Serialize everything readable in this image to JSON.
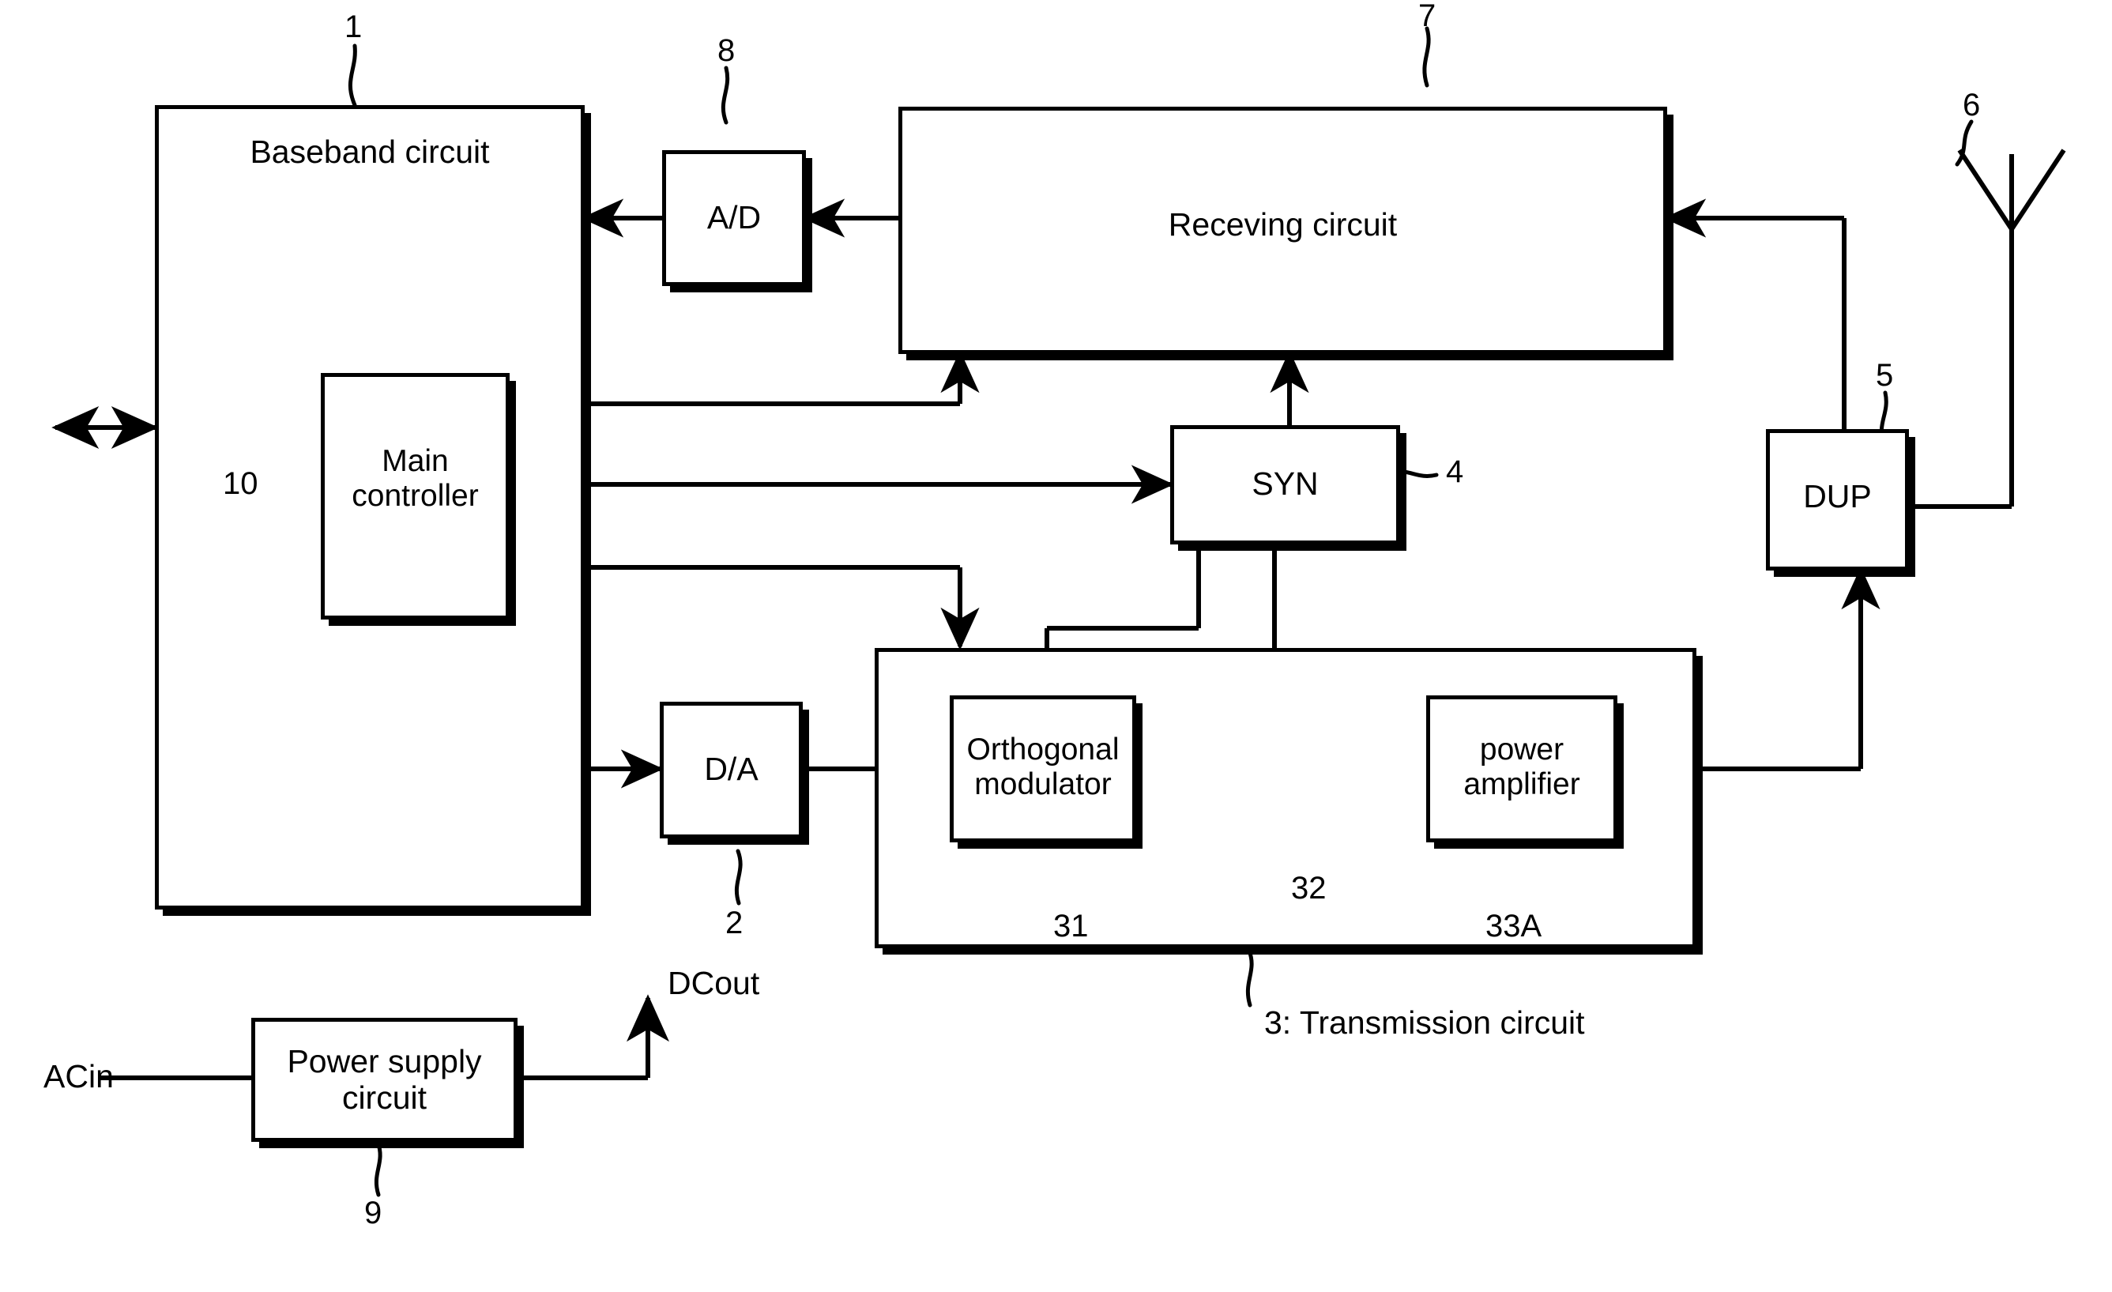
{
  "figure": {
    "kind": "block-diagram",
    "line_color": "#000000",
    "background": "#ffffff"
  },
  "blocks": {
    "baseband": {
      "label": "Baseband circuit",
      "ref": "1"
    },
    "main_controller": {
      "label": "Main\ncontroller",
      "ref": "10"
    },
    "ad": {
      "label": "A/D",
      "ref": "8"
    },
    "da": {
      "label": "D/A",
      "ref": "2"
    },
    "receiving": {
      "label": "Receving circuit",
      "ref": "7"
    },
    "syn": {
      "label": "SYN",
      "ref": "4"
    },
    "dup": {
      "label": "DUP",
      "ref": "5"
    },
    "antenna": {
      "ref": "6"
    },
    "transmission": {
      "label": "3: Transmission circuit"
    },
    "orthogonal_modulator": {
      "label": "Orthogonal\nmodulator",
      "ref": "31"
    },
    "mixer": {
      "ref": "32"
    },
    "power_amplifier": {
      "label": "power\namplifier",
      "ref": "33A"
    },
    "power_supply": {
      "label": "Power  supply\ncircuit",
      "ref": "9"
    }
  },
  "signals": {
    "ac_in": "ACin",
    "dc_out": "DCout"
  }
}
